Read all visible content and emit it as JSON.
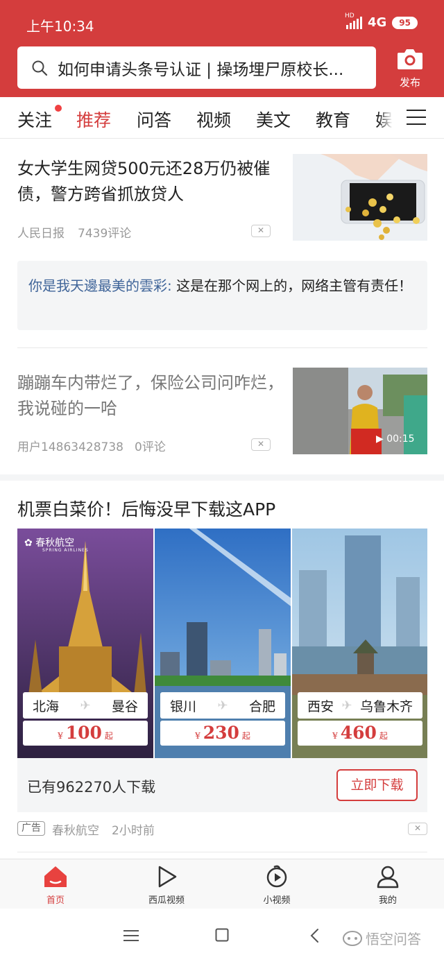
{
  "status_bar": {
    "time": "上午10:34",
    "hd": "HD",
    "network": "4G",
    "battery": "95"
  },
  "search": {
    "query": "如何申请头条号认证 | 操场埋尸原校长..."
  },
  "publish": {
    "label": "发布"
  },
  "tabs": [
    "关注",
    "推荐",
    "问答",
    "视频",
    "美文",
    "教育",
    "娱"
  ],
  "tabs_active_index": 1,
  "articles": [
    {
      "title": "女大学生网贷500元还28万仍被催债，警方跨省抓放贷人",
      "source": "人民日报",
      "comments": "7439评论",
      "comment_user": "你是我天邊最美的雲彩:",
      "comment_text": " 这是在那个网上的，网络主管有责任！"
    },
    {
      "title": "蹦蹦车内带烂了，保险公司问咋烂，我说碰的一哈",
      "source": "用户14863428738",
      "comments": "0评论",
      "video_duration": "00:15"
    }
  ],
  "ad": {
    "title": "机票白菜价！后悔没早下载这APP",
    "logo_text": "春秋航空",
    "logo_sub": "SPRING AIRLINES",
    "routes": [
      {
        "from": "北海",
        "to": "曼谷",
        "currency": "¥",
        "price": "100",
        "suffix": "起"
      },
      {
        "from": "银川",
        "to": "合肥",
        "currency": "¥",
        "price": "230",
        "suffix": "起"
      },
      {
        "from": "西安",
        "to": "乌鲁木齐",
        "currency": "¥",
        "price": "460",
        "suffix": "起"
      }
    ],
    "downloads": "已有962270人下载",
    "download_button": "立即下载",
    "tag": "广告",
    "advertiser": "春秋航空",
    "time": "2小时前"
  },
  "bottom_nav": [
    {
      "label": "首页",
      "icon": "home-icon"
    },
    {
      "label": "西瓜视频",
      "icon": "play-icon"
    },
    {
      "label": "小视频",
      "icon": "short-video-icon"
    },
    {
      "label": "我的",
      "icon": "user-icon"
    }
  ],
  "watermark": "悟空问答",
  "colors": {
    "brand": "#d43d3d",
    "link": "#406599",
    "background_gray": "#f4f5f6"
  }
}
